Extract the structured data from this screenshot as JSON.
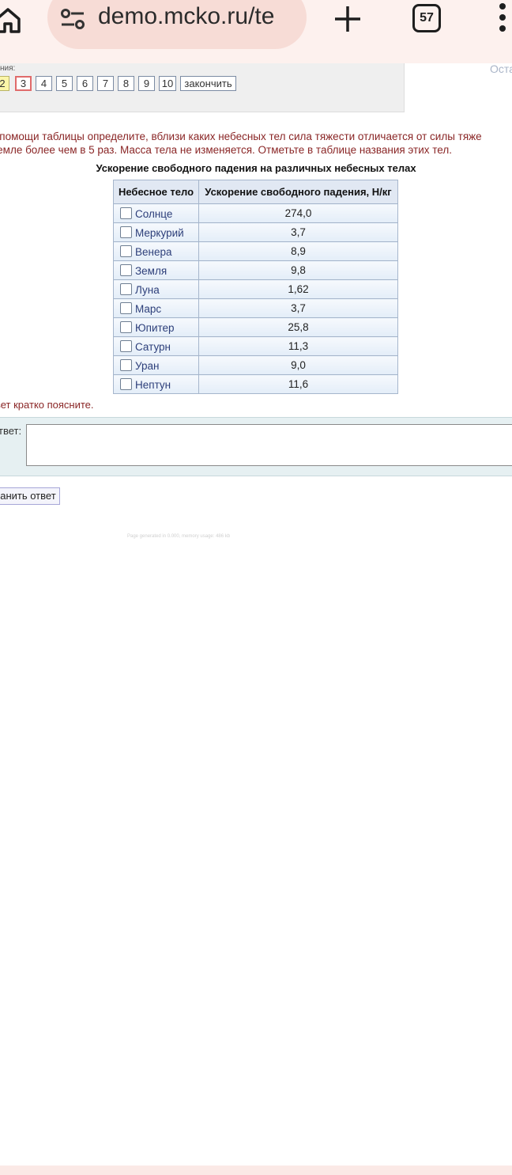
{
  "browser": {
    "url": "demo.mcko.ru/te",
    "tab_count": "57"
  },
  "nav": {
    "label": "ния:",
    "tasks": [
      "2",
      "3",
      "4",
      "5",
      "6",
      "7",
      "8",
      "9",
      "10"
    ],
    "finish_label": "закончить",
    "remaining": "Оста"
  },
  "question": {
    "line1": "и помощи таблицы определите, вблизи каких небесных тел сила тяжести отличается от силы тяже",
    "line2": " Земле более чем в 5 раз. Масса тела не изменяется. Отметьте в таблице названия этих тел."
  },
  "table": {
    "caption": "Ускорение свободного падения на различных небесных телах",
    "headers": [
      "Небесное тело",
      "Ускорение свободного падения, Н/кг"
    ],
    "rows": [
      {
        "name": "Солнце",
        "value": "274,0"
      },
      {
        "name": "Меркурий",
        "value": "3,7"
      },
      {
        "name": "Венера",
        "value": "8,9"
      },
      {
        "name": "Земля",
        "value": "9,8"
      },
      {
        "name": "Луна",
        "value": "1,62"
      },
      {
        "name": "Марс",
        "value": "3,7"
      },
      {
        "name": "Юпитер",
        "value": "25,8"
      },
      {
        "name": "Сатурн",
        "value": "11,3"
      },
      {
        "name": "Уран",
        "value": "9,0"
      },
      {
        "name": "Нептун",
        "value": "11,6"
      }
    ]
  },
  "explain_text": "вет кратко поясните.",
  "answer": {
    "label": "твет:",
    "value": ""
  },
  "save_label": "ранить ответ",
  "footer_note": "Page generated in 0.000, memory usage: 486 kb"
}
